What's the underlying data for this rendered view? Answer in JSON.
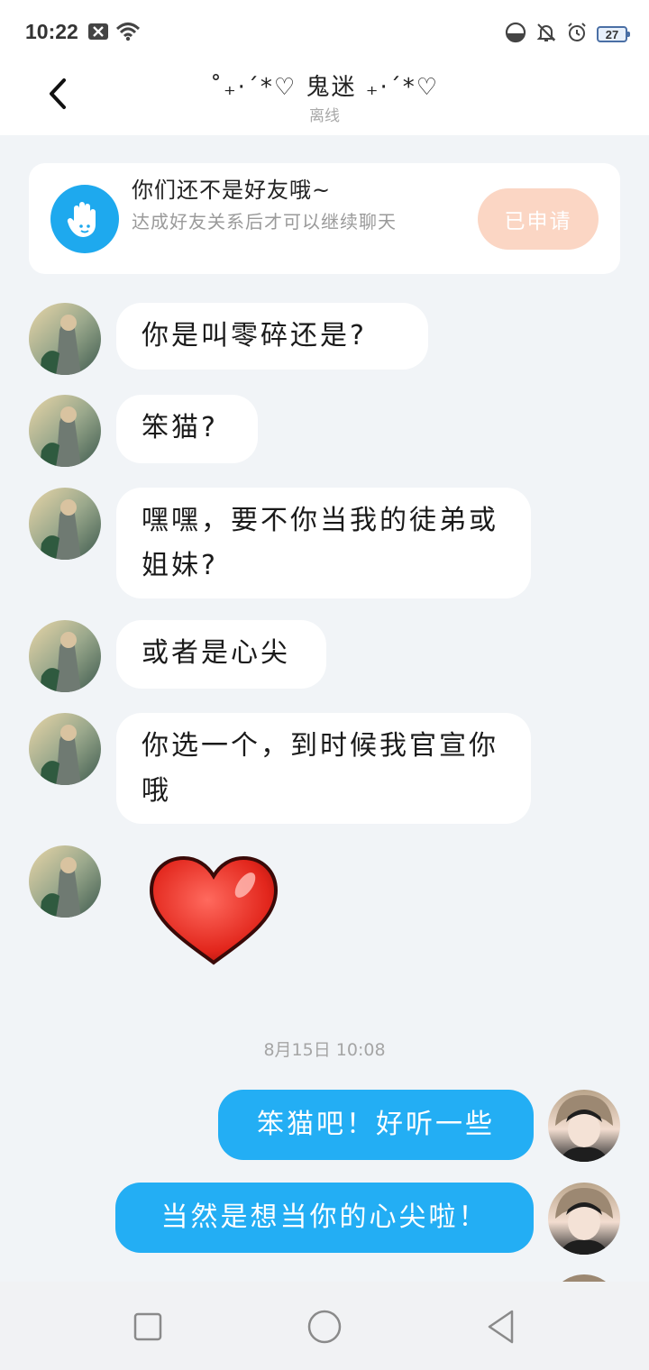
{
  "status_bar": {
    "time": "10:22",
    "battery": "27"
  },
  "header": {
    "title": "˚₊·ˊ*♡  鬼迷  ₊·ˊ*♡",
    "subtitle": "离线"
  },
  "friend_notice": {
    "title": "你们还不是好友哦~",
    "description": "达成好友关系后才可以继续聊天",
    "button_label": "已申请"
  },
  "messages_incoming": [
    {
      "text": "你是叫零碎还是?"
    },
    {
      "text": "笨猫?"
    },
    {
      "text": "嘿嘿，要不你当我的徒弟或姐妹?"
    },
    {
      "text": "或者是心尖"
    },
    {
      "text": "你选一个，到时候我官宣你哦"
    }
  ],
  "timestamp": "8月15日 10:08",
  "messages_outgoing": [
    {
      "text": "笨猫吧！好听一些"
    },
    {
      "text": "当然是想当你的心尖啦！"
    }
  ],
  "colors": {
    "accent": "#23aef4",
    "applied_button": "#fbd6c4",
    "background": "#f1f4f7"
  }
}
